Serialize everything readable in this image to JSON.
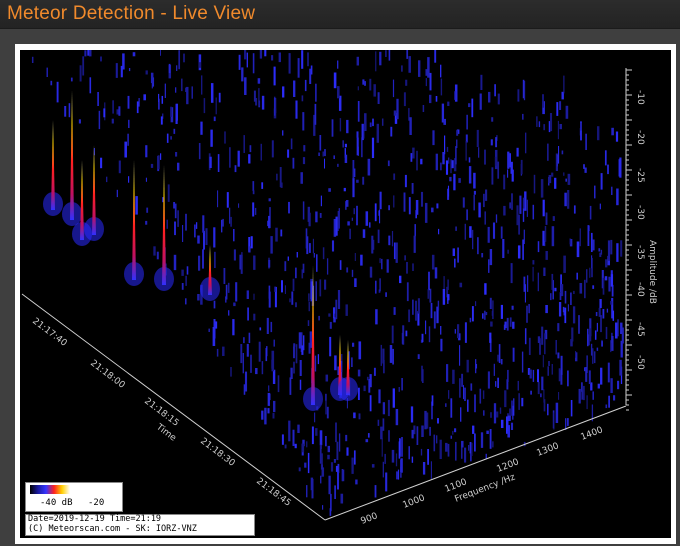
{
  "window": {
    "title": "Meteor Detection - Live View"
  },
  "plot": {
    "time_axis": {
      "label": "Time",
      "ticks": [
        "21:17:40",
        "21:18:00",
        "21:18:15",
        "21:18:30",
        "21:18:45"
      ]
    },
    "frequency_axis": {
      "label": "Frequency /Hz",
      "ticks": [
        "900",
        "1000",
        "1100",
        "1200",
        "1300",
        "1400"
      ]
    },
    "amplitude_axis": {
      "label": "Amplitude /dB",
      "ticks": [
        "-10",
        "-20",
        "-25",
        "-30",
        "-35",
        "-40",
        "-45",
        "-50"
      ]
    },
    "color_scale": {
      "min_label": "-40 dB",
      "max_label": "-20"
    },
    "info": {
      "line1": "Date=2019-12-19 Time=21:19",
      "line2": "(C) Meteorscan.com - SK: IORZ-VNZ"
    },
    "colors": {
      "background": "#000000",
      "noise": "#2a2ad0",
      "peak_low": "#ff2020",
      "peak_high": "#ffd700"
    }
  }
}
